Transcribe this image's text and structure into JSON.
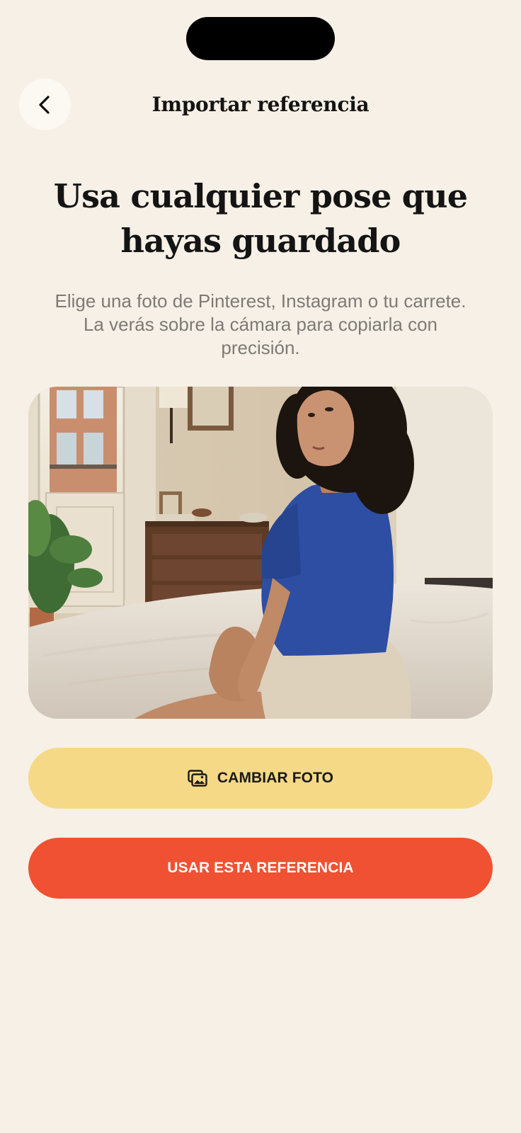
{
  "header": {
    "title": "Importar referencia",
    "back_icon": "chevron-left-icon"
  },
  "intro": {
    "headline": "Usa cualquier pose que hayas guardado",
    "description": "Elige una foto de Pinterest, Instagram o tu carrete. La verás sobre la cámara para copiarla con precisión."
  },
  "reference_photo": {
    "description_icon": "reference-photo"
  },
  "actions": {
    "change_photo_label": "CAMBIAR FOTO",
    "change_photo_icon": "photo-gallery-icon",
    "use_reference_label": "USAR ESTA REFERENCIA"
  },
  "colors": {
    "background": "#f7f0e6",
    "change_button": "#f6d986",
    "use_button": "#ef5132",
    "text": "#141414",
    "muted_text": "#7d7a76"
  }
}
